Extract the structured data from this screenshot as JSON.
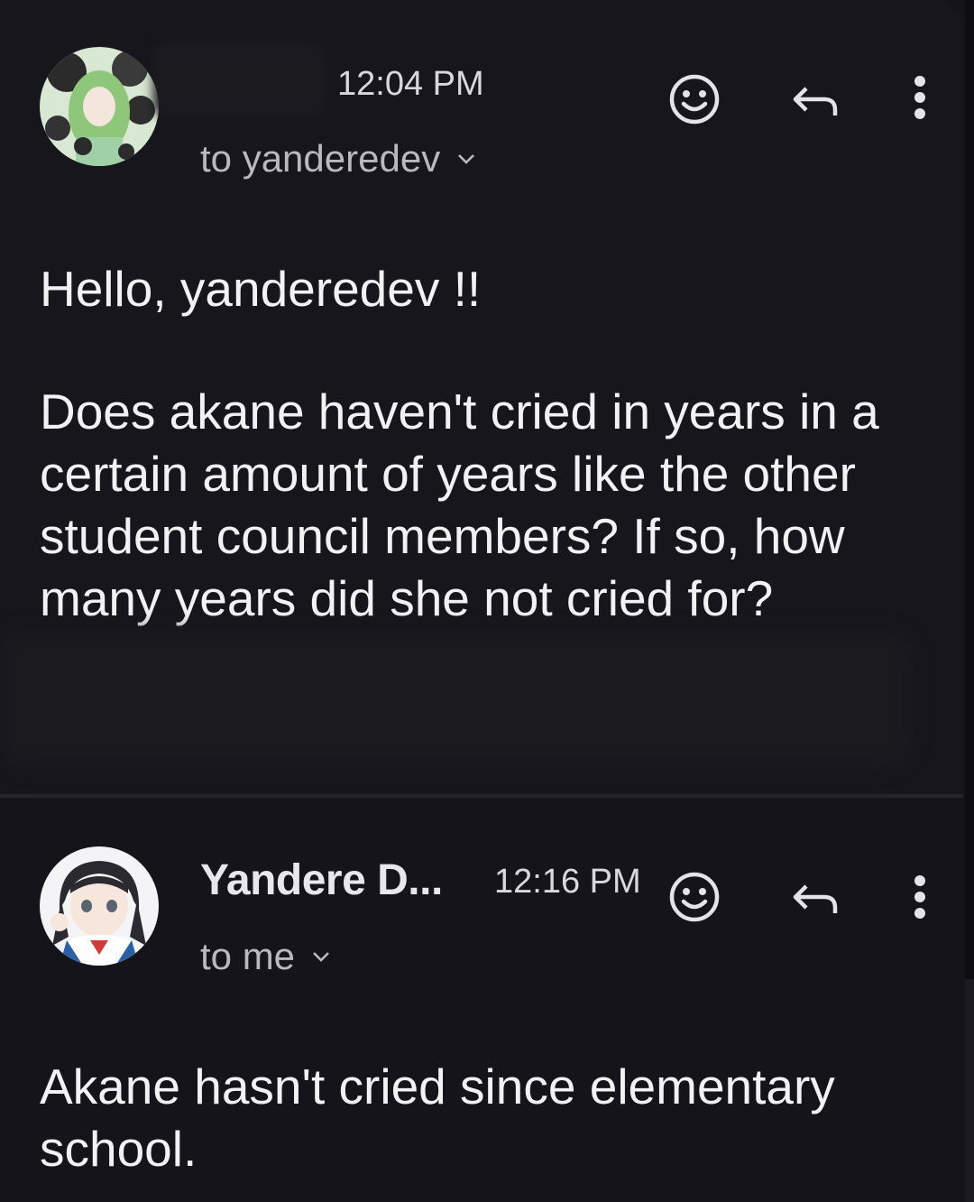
{
  "messages": [
    {
      "sender": "",
      "time": "12:04 PM",
      "to": "to yanderedev",
      "greeting": "Hello, yanderedev !!",
      "body": "Does akane haven't cried in years in a certain amount of years like the other student council members? If so, how many years did she not cried for?"
    },
    {
      "sender": "Yandere D...",
      "time": "12:16 PM",
      "to": "to me",
      "body": "Akane hasn't cried since elementary school."
    }
  ],
  "icons": {
    "react": "smiley-face-icon",
    "reply": "reply-arrow-icon",
    "more": "more-vertical-icon",
    "expand": "chevron-down-icon"
  },
  "colors": {
    "background": "#14141a",
    "text": "#f2f2f4",
    "secondary_text": "#b9b9c0"
  }
}
